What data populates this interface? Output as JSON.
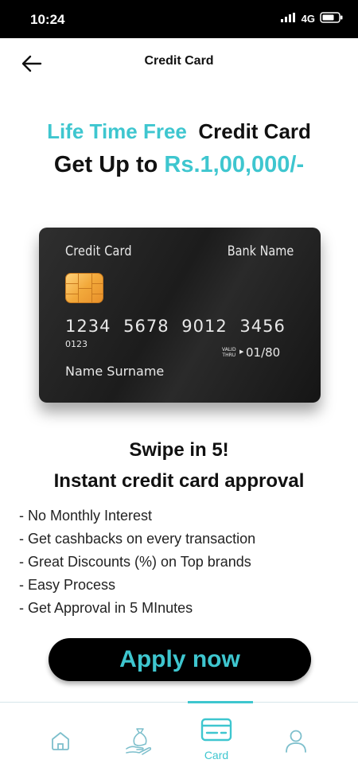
{
  "status_bar": {
    "time": "10:24",
    "network": "4G"
  },
  "header": {
    "title": "Credit Card"
  },
  "promo": {
    "line1_accent": "Life Time Free",
    "line1_dark": "Credit Card",
    "line2_dark": "Get Up to",
    "line2_accent": "Rs.1,00,000/-"
  },
  "card": {
    "type_label": "Credit Card",
    "bank_name": "Bank Name",
    "number": "1234 5678 9012 3456",
    "small_number": "0123",
    "valid_label_1": "VALID",
    "valid_label_2": "THRU",
    "valid_date": "01/80",
    "holder_name": "Name Surname"
  },
  "headline": {
    "swipe": "Swipe in 5!",
    "instant": "Instant credit card approval"
  },
  "features": [
    "- No Monthly Interest",
    "- Get cashbacks on every transaction",
    "- Great Discounts (%) on Top brands",
    "- Easy Process",
    "- Get Approval in 5 MInutes"
  ],
  "apply_button": {
    "label": "Apply now"
  },
  "bottom_nav": {
    "active_label": "Card",
    "items": [
      "home-icon",
      "money-bag-icon",
      "card-icon",
      "profile-icon"
    ]
  },
  "colors": {
    "accent": "#3ec6cf",
    "status_bar": "#000000",
    "card_bg": "#1f1f1f",
    "chip": "#f2a93b"
  }
}
